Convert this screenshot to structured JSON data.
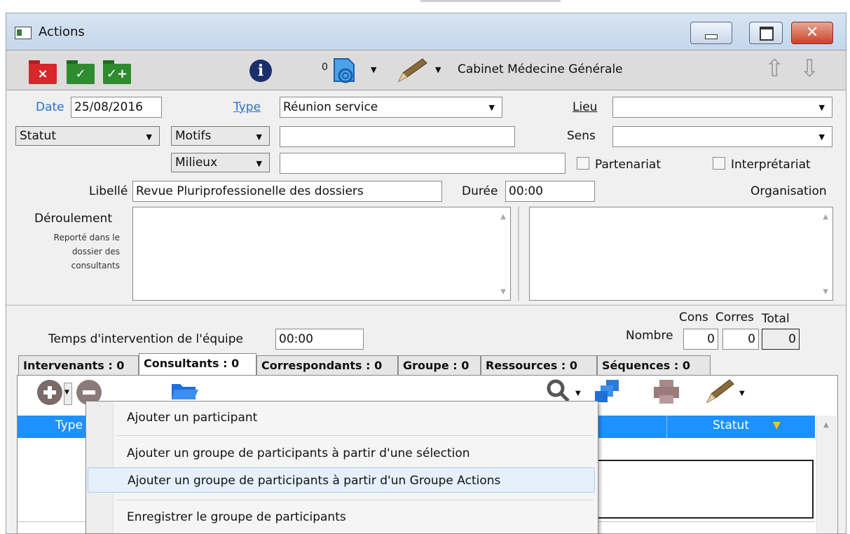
{
  "window": {
    "title": "Actions",
    "close_glyph": "✕"
  },
  "toolbar": {
    "folder_cancel_glyph": "×",
    "folder_ok_glyph": "✓",
    "folder_okplus_glyph": "✓+",
    "info_glyph": "i",
    "attachments_count": "0",
    "cabinet": "Cabinet Médecine Générale",
    "arrow_up": "⇧",
    "arrow_down": "⇩"
  },
  "form": {
    "date_label": "Date",
    "date_value": "25/08/2016",
    "type_label": "Type",
    "type_value": "Réunion service",
    "lieu_label": "Lieu",
    "lieu_value": "",
    "statut_label": "Statut",
    "motifs_label": "Motifs",
    "motifs_value": "",
    "sens_label": "Sens",
    "sens_value": "",
    "milieux_label": "Milieux",
    "milieux_value": "",
    "partenariat_label": "Partenariat",
    "interpretariat_label": "Interprétariat",
    "libelle_label": "Libellé",
    "libelle_value": "Revue Pluriprofessionelle des dossiers",
    "duree_label": "Durée",
    "duree_value": "00:00",
    "organisation_label": "Organisation",
    "deroulement_label": "Déroulement",
    "deroulement_note_1": "Reporté dans le",
    "deroulement_note_2": "dossier des",
    "deroulement_note_3": "consultants",
    "temps_label": "Temps d'intervention de l'équipe",
    "temps_value": "00:00",
    "cons_label": "Cons",
    "corres_label": "Corres",
    "total_label": "Total",
    "nombre_label": "Nombre",
    "cons_value": "0",
    "corres_value": "0",
    "total_value": "0"
  },
  "tabs": [
    {
      "label": "Intervenants : 0"
    },
    {
      "label": "Consultants : 0"
    },
    {
      "label": "Correspondants : 0"
    },
    {
      "label": "Groupe : 0"
    },
    {
      "label": "Ressources : 0"
    },
    {
      "label": "Séquences : 0"
    }
  ],
  "list": {
    "col_type": "Type",
    "col_statut": "Statut"
  },
  "menu": {
    "items": [
      "Ajouter un participant",
      "Ajouter un groupe de participants à partir d'une sélection",
      "Ajouter un groupe de participants à partir d'un Groupe Actions",
      "Enregistrer le groupe de participants"
    ]
  },
  "colors": {
    "accent": "#1e90ff",
    "folder_red": "#d9262b",
    "folder_green": "#2e8b2e",
    "info_navy": "#1a2f6b"
  }
}
